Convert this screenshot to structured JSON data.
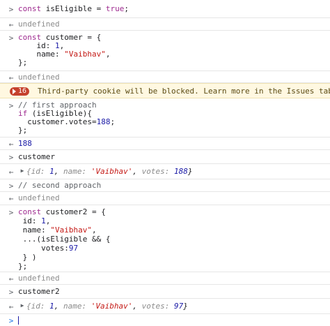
{
  "console": {
    "entries": [
      {
        "type": "input",
        "lines": [
          "const isEligible = true;"
        ]
      },
      {
        "type": "output",
        "text": "undefined"
      },
      {
        "type": "input",
        "lines": [
          "const customer = {",
          "    id: 1,",
          "    name: \"Vaibhav\",",
          "};"
        ]
      },
      {
        "type": "output",
        "text": "undefined"
      },
      {
        "type": "warning",
        "count": "16",
        "text": "Third-party cookie will be blocked. Learn more in the Issues tab."
      },
      {
        "type": "input",
        "lines": [
          "// first approach",
          "if (isEligible){",
          "  customer.votes=188;",
          "};"
        ]
      },
      {
        "type": "output",
        "text": "188"
      },
      {
        "type": "input",
        "lines": [
          "customer"
        ]
      },
      {
        "type": "output-object",
        "text": "{id: 1, name: 'Vaibhav', votes: 188}"
      },
      {
        "type": "input",
        "lines": [
          "// second approach"
        ]
      },
      {
        "type": "output",
        "text": "undefined"
      },
      {
        "type": "input",
        "lines": [
          "const customer2 = {",
          " id: 1,",
          " name: \"Vaibhav\",",
          " ...(isEligible && {",
          "     votes:97",
          " } )",
          "};"
        ]
      },
      {
        "type": "output",
        "text": "undefined"
      },
      {
        "type": "input",
        "lines": [
          "customer2"
        ]
      },
      {
        "type": "output-object",
        "text": "{id: 1, name: 'Vaibhav', votes: 97}"
      },
      {
        "type": "prompt",
        "text": ""
      }
    ],
    "glyphs": {
      "input": ">",
      "output": "←",
      "expand": "▶"
    }
  }
}
